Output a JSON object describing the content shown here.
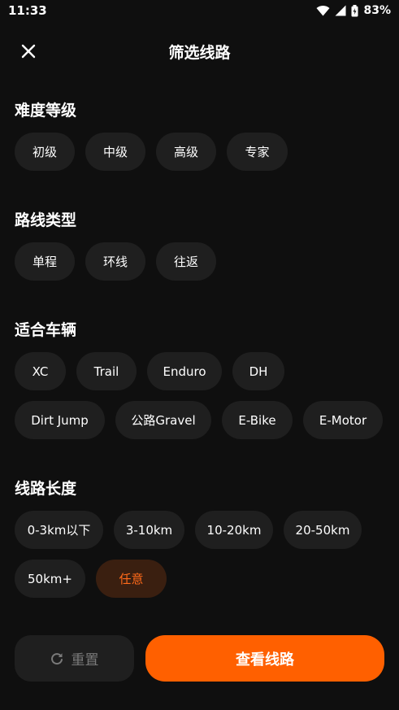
{
  "status_bar": {
    "time": "11:33",
    "battery": "83%"
  },
  "header": {
    "title": "筛选线路"
  },
  "sections": {
    "difficulty": {
      "title": "难度等级",
      "options": [
        "初级",
        "中级",
        "高级",
        "专家"
      ]
    },
    "route_type": {
      "title": "路线类型",
      "options": [
        "单程",
        "环线",
        "往返"
      ]
    },
    "vehicle": {
      "title": "适合车辆",
      "options": [
        "XC",
        "Trail",
        "Enduro",
        "DH",
        "Dirt Jump",
        "公路Gravel",
        "E-Bike",
        "E-Motor"
      ]
    },
    "length": {
      "title": "线路长度",
      "options": [
        "0-3km以下",
        "3-10km",
        "10-20km",
        "20-50km",
        "50km+",
        "任意"
      ],
      "selected": "任意"
    }
  },
  "actions": {
    "reset_label": "重置",
    "apply_label": "查看线路"
  },
  "colors": {
    "accent": "#ff6000",
    "selected_text": "#ff6a1a",
    "chip_bg": "#1f1f1f",
    "background": "#0f0f0f"
  },
  "icons": {
    "close": "close-icon",
    "reset": "refresh-icon",
    "wifi": "wifi-icon",
    "signal": "signal-icon",
    "battery": "battery-icon"
  }
}
